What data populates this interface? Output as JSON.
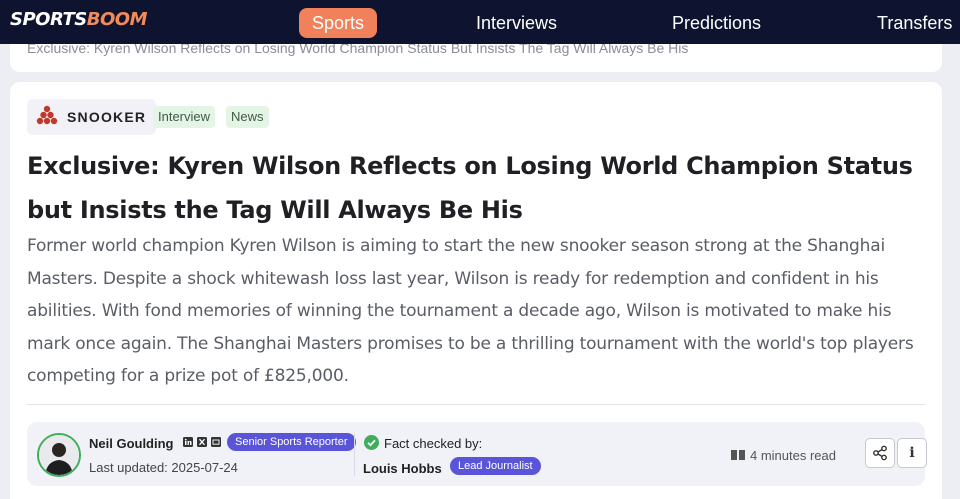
{
  "nav": {
    "logo_part1": "SPORTS",
    "logo_part2": "BOOM",
    "items": [
      {
        "label": "Sports",
        "active": true
      },
      {
        "label": "Interviews",
        "active": false
      },
      {
        "label": "Predictions",
        "active": false
      },
      {
        "label": "Transfers",
        "active": false
      }
    ]
  },
  "breadcrumb": {
    "text": "Exclusive: Kyren Wilson Reflects on Losing World Champion Status But Insists The Tag Will Always Be His"
  },
  "article": {
    "sport": "SNOOKER",
    "sport_icon": "snooker-balls-icon",
    "tags": [
      "Interview",
      "News"
    ],
    "title": "Exclusive: Kyren Wilson Reflects on Losing World Champion Status but Insists the Tag Will Always Be His",
    "summary": "Former world champion Kyren Wilson is aiming to start the new snooker season strong at the Shanghai Masters. Despite a shock whitewash loss last year, Wilson is ready for redemption and confident in his abilities. With fond memories of winning the tournament a decade ago, Wilson is motivated to make his mark once again. The Shanghai Masters promises to be a thrilling tournament with the world's top players competing for a prize pot of £825,000."
  },
  "meta": {
    "author": "Neil Goulding",
    "author_role": "Senior Sports Reporter",
    "social_icons": [
      "linkedin-icon",
      "x-icon",
      "email-icon"
    ],
    "updated": "Last updated: 2025-07-24",
    "fact_check_label": "Fact checked by:",
    "fact_checker": "Louis Hobbs",
    "fact_checker_role": "Lead Journalist",
    "read_time": "4 minutes read"
  },
  "colors": {
    "nav_bg": "#0e1430",
    "accent": "#f0815b",
    "badge": "#5a55d8",
    "tag_bg": "#e4f5e6",
    "check": "#3fae5a"
  }
}
